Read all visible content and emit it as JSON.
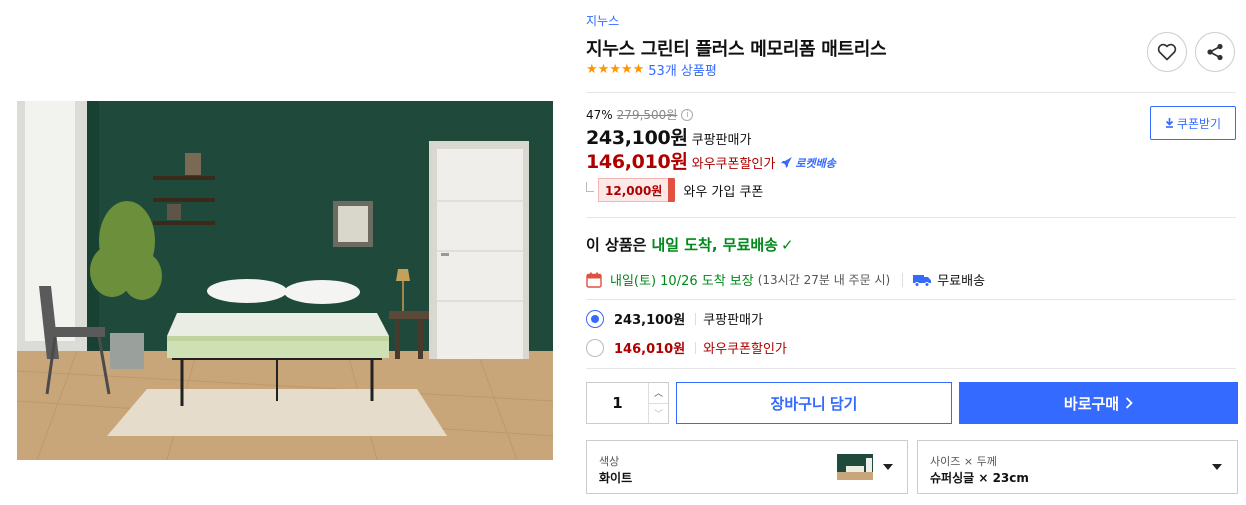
{
  "product": {
    "brand": "지누스",
    "title": "지누스 그린티 플러스 메모리폼 매트리스",
    "review_count": "53개 상품평",
    "rating_stars": 5,
    "image_alt": "지누스 그린티 플러스 메모리폼 매트리스"
  },
  "pricing": {
    "discount_rate": "47%",
    "original_price": "279,500원",
    "coupon_button": "쿠폰받기",
    "sale_price": "243,100원",
    "sale_label": "쿠팡판매가",
    "wow_price": "146,010원",
    "wow_label": "와우쿠폰할인가",
    "rocket_label": "로켓배송",
    "wow_coupon_amount": "12,000원",
    "wow_coupon_label": "와우 가입 쿠폰"
  },
  "delivery": {
    "headline_prefix": "이 상품은",
    "headline_green": "내일 도착, 무료배송",
    "date_text": "내일(토) 10/26 도착 보장",
    "date_sub": "(13시간 27분 내 주문 시)",
    "free_shipping": "무료배송"
  },
  "options": [
    {
      "price": "243,100원",
      "label": "쿠팡판매가",
      "selected": true
    },
    {
      "price": "146,010원",
      "label": "와우쿠폰할인가",
      "selected": false
    }
  ],
  "purchase": {
    "quantity": "1",
    "cart_button": "장바구니 담기",
    "buy_button": "바로구매"
  },
  "selectors": {
    "color_label": "색상",
    "color_value": "화이트",
    "size_label": "사이즈 × 두께",
    "size_value": "슈퍼싱글 × 23cm"
  },
  "colors": {
    "accent": "#346aff",
    "price_red": "#ae0000",
    "delivery_green": "#00891a",
    "star_orange": "#ff9600"
  },
  "icons": [
    "heart-icon",
    "share-icon",
    "info-icon",
    "download-icon",
    "rocket-icon",
    "check-icon",
    "calendar-icon",
    "truck-icon",
    "chevron-right-icon",
    "chevron-down-icon"
  ]
}
